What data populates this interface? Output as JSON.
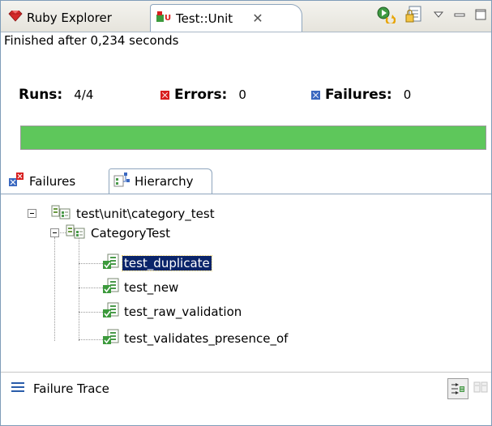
{
  "tabs": [
    {
      "label": "Ruby Explorer",
      "icon": "ruby-gem-icon"
    },
    {
      "label": "Test::Unit",
      "icon": "test-unit-icon",
      "close_glyph": "✕",
      "active": true
    }
  ],
  "toolbar": {
    "icons": [
      "rerun-tests-icon",
      "history-icon",
      "view-menu-chevron-icon",
      "minimize-icon",
      "maximize-icon"
    ]
  },
  "status": "Finished after 0,234 seconds",
  "counters": {
    "runs_label": "Runs:",
    "runs_value": "4/4",
    "errors_label": "Errors:",
    "errors_value": "0",
    "failures_label": "Failures:",
    "failures_value": "0"
  },
  "progress": {
    "fraction": 1.0,
    "color": "#5ec75b"
  },
  "subtabs": [
    {
      "label": "Failures",
      "icon": "failures-icon"
    },
    {
      "label": "Hierarchy",
      "icon": "hierarchy-icon",
      "active": true
    }
  ],
  "tree": {
    "suite": "test\\unit\\category_test",
    "testcase": "CategoryTest",
    "tests": [
      {
        "name": "test_duplicate",
        "selected": true
      },
      {
        "name": "test_new",
        "selected": false
      },
      {
        "name": "test_raw_validation",
        "selected": false
      },
      {
        "name": "test_validates_presence_of",
        "selected": false
      }
    ]
  },
  "trace": {
    "title": "Failure Trace"
  },
  "colors": {
    "accent": "#0a246a",
    "success": "#5ec75b",
    "error": "#d81e1e",
    "failure": "#3a68c0"
  }
}
